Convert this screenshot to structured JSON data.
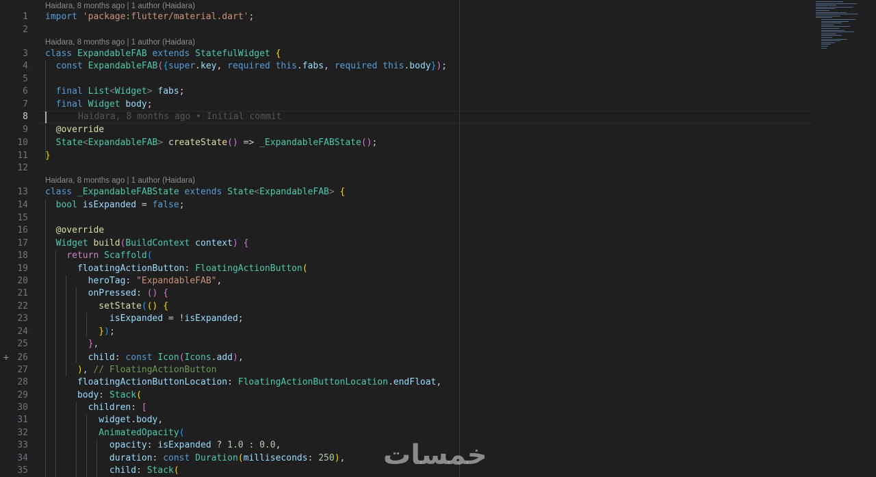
{
  "editor": {
    "theme_colors": {
      "background": "#1f1f1f",
      "keyword": "#569cd6",
      "control": "#c586c0",
      "type": "#4ec9b0",
      "function": "#dcdcaa",
      "variable": "#9cdcfe",
      "string": "#ce9178",
      "number": "#b5cea8",
      "comment": "#6a9955"
    },
    "gutter_marker": "+",
    "line_numbers": [
      "1",
      "2",
      "3",
      "4",
      "5",
      "6",
      "7",
      "8",
      "9",
      "10",
      "11",
      "12",
      "13",
      "14",
      "15",
      "16",
      "17",
      "18",
      "19",
      "20",
      "21",
      "22",
      "23",
      "24",
      "25",
      "26",
      "27",
      "28",
      "29",
      "30",
      "31",
      "32",
      "33",
      "34",
      "35"
    ],
    "active_line": "8",
    "codelens": [
      "Haidara, 8 months ago | 1 author (Haidara)",
      "Haidara, 8 months ago | 1 author (Haidara)",
      "Haidara, 8 months ago | 1 author (Haidara)"
    ],
    "inline_blame": "Haidara, 8 months ago • Initial commit",
    "lines": [
      [
        [
          "k",
          "import"
        ],
        [
          "p",
          " "
        ],
        [
          "s",
          "'package:flutter/material.dart'"
        ],
        [
          "p",
          ";"
        ]
      ],
      [],
      [
        [
          "k",
          "class"
        ],
        [
          "p",
          " "
        ],
        [
          "t",
          "ExpandableFAB"
        ],
        [
          "p",
          " "
        ],
        [
          "k",
          "extends"
        ],
        [
          "p",
          " "
        ],
        [
          "t",
          "StatefulWidget"
        ],
        [
          "p",
          " "
        ],
        [
          "b1",
          "{"
        ]
      ],
      [
        [
          "p",
          "  "
        ],
        [
          "k",
          "const"
        ],
        [
          "p",
          " "
        ],
        [
          "t",
          "ExpandableFAB"
        ],
        [
          "b2",
          "("
        ],
        [
          "b3",
          "{"
        ],
        [
          "k",
          "super"
        ],
        [
          "p",
          "."
        ],
        [
          "v",
          "key"
        ],
        [
          "p",
          ", "
        ],
        [
          "k",
          "required"
        ],
        [
          "p",
          " "
        ],
        [
          "k",
          "this"
        ],
        [
          "p",
          "."
        ],
        [
          "v",
          "fabs"
        ],
        [
          "p",
          ", "
        ],
        [
          "k",
          "required"
        ],
        [
          "p",
          " "
        ],
        [
          "k",
          "this"
        ],
        [
          "p",
          "."
        ],
        [
          "v",
          "body"
        ],
        [
          "b3",
          "}"
        ],
        [
          "b2",
          ")"
        ],
        [
          "p",
          ";"
        ]
      ],
      [],
      [
        [
          "p",
          "  "
        ],
        [
          "k",
          "final"
        ],
        [
          "p",
          " "
        ],
        [
          "t",
          "List"
        ],
        [
          "gt",
          "<"
        ],
        [
          "t",
          "Widget"
        ],
        [
          "gt",
          ">"
        ],
        [
          "p",
          " "
        ],
        [
          "v",
          "fabs"
        ],
        [
          "p",
          ";"
        ]
      ],
      [
        [
          "p",
          "  "
        ],
        [
          "k",
          "final"
        ],
        [
          "p",
          " "
        ],
        [
          "t",
          "Widget"
        ],
        [
          "p",
          " "
        ],
        [
          "v",
          "body"
        ],
        [
          "p",
          ";"
        ]
      ],
      [],
      [
        [
          "p",
          "  "
        ],
        [
          "f",
          "@override"
        ]
      ],
      [
        [
          "p",
          "  "
        ],
        [
          "t",
          "State"
        ],
        [
          "gt",
          "<"
        ],
        [
          "t",
          "ExpandableFAB"
        ],
        [
          "gt",
          ">"
        ],
        [
          "p",
          " "
        ],
        [
          "f",
          "createState"
        ],
        [
          "b2",
          "()"
        ],
        [
          "p",
          " => "
        ],
        [
          "t",
          "_ExpandableFABState"
        ],
        [
          "b2",
          "()"
        ],
        [
          "p",
          ";"
        ]
      ],
      [
        [
          "b1",
          "}"
        ]
      ],
      [],
      [
        [
          "k",
          "class"
        ],
        [
          "p",
          " "
        ],
        [
          "t",
          "_ExpandableFABState"
        ],
        [
          "p",
          " "
        ],
        [
          "k",
          "extends"
        ],
        [
          "p",
          " "
        ],
        [
          "t",
          "State"
        ],
        [
          "gt",
          "<"
        ],
        [
          "t",
          "ExpandableFAB"
        ],
        [
          "gt",
          ">"
        ],
        [
          "p",
          " "
        ],
        [
          "b1",
          "{"
        ]
      ],
      [
        [
          "p",
          "  "
        ],
        [
          "t",
          "bool"
        ],
        [
          "p",
          " "
        ],
        [
          "v",
          "isExpanded"
        ],
        [
          "p",
          " = "
        ],
        [
          "k",
          "false"
        ],
        [
          "p",
          ";"
        ]
      ],
      [],
      [
        [
          "p",
          "  "
        ],
        [
          "f",
          "@override"
        ]
      ],
      [
        [
          "p",
          "  "
        ],
        [
          "t",
          "Widget"
        ],
        [
          "p",
          " "
        ],
        [
          "f",
          "build"
        ],
        [
          "b2",
          "("
        ],
        [
          "t",
          "BuildContext"
        ],
        [
          "p",
          " "
        ],
        [
          "v",
          "context"
        ],
        [
          "b2",
          ")"
        ],
        [
          "p",
          " "
        ],
        [
          "b2",
          "{"
        ]
      ],
      [
        [
          "p",
          "    "
        ],
        [
          "c",
          "return"
        ],
        [
          "p",
          " "
        ],
        [
          "t",
          "Scaffold"
        ],
        [
          "b3",
          "("
        ]
      ],
      [
        [
          "p",
          "      "
        ],
        [
          "v",
          "floatingActionButton"
        ],
        [
          "p",
          ": "
        ],
        [
          "t",
          "FloatingActionButton"
        ],
        [
          "b1",
          "("
        ]
      ],
      [
        [
          "p",
          "        "
        ],
        [
          "v",
          "heroTag"
        ],
        [
          "p",
          ": "
        ],
        [
          "s",
          "\"ExpandableFAB\""
        ],
        [
          "p",
          ","
        ]
      ],
      [
        [
          "p",
          "        "
        ],
        [
          "v",
          "onPressed"
        ],
        [
          "p",
          ": "
        ],
        [
          "b2",
          "()"
        ],
        [
          "p",
          " "
        ],
        [
          "b2",
          "{"
        ]
      ],
      [
        [
          "p",
          "          "
        ],
        [
          "f",
          "setState"
        ],
        [
          "b3",
          "("
        ],
        [
          "b1",
          "()"
        ],
        [
          "p",
          " "
        ],
        [
          "b1",
          "{"
        ]
      ],
      [
        [
          "p",
          "            "
        ],
        [
          "v",
          "isExpanded"
        ],
        [
          "p",
          " = !"
        ],
        [
          "v",
          "isExpanded"
        ],
        [
          "p",
          ";"
        ]
      ],
      [
        [
          "p",
          "          "
        ],
        [
          "b1",
          "}"
        ],
        [
          "b3",
          ")"
        ],
        [
          "p",
          ";"
        ]
      ],
      [
        [
          "p",
          "        "
        ],
        [
          "b2",
          "}"
        ],
        [
          "p",
          ","
        ]
      ],
      [
        [
          "p",
          "        "
        ],
        [
          "v",
          "child"
        ],
        [
          "p",
          ": "
        ],
        [
          "k",
          "const"
        ],
        [
          "p",
          " "
        ],
        [
          "t",
          "Icon"
        ],
        [
          "b2",
          "("
        ],
        [
          "t",
          "Icons"
        ],
        [
          "p",
          "."
        ],
        [
          "v",
          "add"
        ],
        [
          "b2",
          ")"
        ],
        [
          "p",
          ","
        ]
      ],
      [
        [
          "p",
          "      "
        ],
        [
          "b1",
          ")"
        ],
        [
          "p",
          ", "
        ],
        [
          "cm",
          "// FloatingActionButton"
        ]
      ],
      [
        [
          "p",
          "      "
        ],
        [
          "v",
          "floatingActionButtonLocation"
        ],
        [
          "p",
          ": "
        ],
        [
          "t",
          "FloatingActionButtonLocation"
        ],
        [
          "p",
          "."
        ],
        [
          "v",
          "endFloat"
        ],
        [
          "p",
          ","
        ]
      ],
      [
        [
          "p",
          "      "
        ],
        [
          "v",
          "body"
        ],
        [
          "p",
          ": "
        ],
        [
          "t",
          "Stack"
        ],
        [
          "b1",
          "("
        ]
      ],
      [
        [
          "p",
          "        "
        ],
        [
          "v",
          "children"
        ],
        [
          "p",
          ": "
        ],
        [
          "b2",
          "["
        ]
      ],
      [
        [
          "p",
          "          "
        ],
        [
          "v",
          "widget"
        ],
        [
          "p",
          "."
        ],
        [
          "v",
          "body"
        ],
        [
          "p",
          ","
        ]
      ],
      [
        [
          "p",
          "          "
        ],
        [
          "t",
          "AnimatedOpacity"
        ],
        [
          "b3",
          "("
        ]
      ],
      [
        [
          "p",
          "            "
        ],
        [
          "v",
          "opacity"
        ],
        [
          "p",
          ": "
        ],
        [
          "v",
          "isExpanded"
        ],
        [
          "p",
          " ? "
        ],
        [
          "n",
          "1.0"
        ],
        [
          "p",
          " : "
        ],
        [
          "n",
          "0.0"
        ],
        [
          "p",
          ","
        ]
      ],
      [
        [
          "p",
          "            "
        ],
        [
          "v",
          "duration"
        ],
        [
          "p",
          ": "
        ],
        [
          "k",
          "const"
        ],
        [
          "p",
          " "
        ],
        [
          "t",
          "Duration"
        ],
        [
          "b1",
          "("
        ],
        [
          "v",
          "milliseconds"
        ],
        [
          "p",
          ": "
        ],
        [
          "n",
          "250"
        ],
        [
          "b1",
          ")"
        ],
        [
          "p",
          ","
        ]
      ],
      [
        [
          "p",
          "            "
        ],
        [
          "v",
          "child"
        ],
        [
          "p",
          ": "
        ],
        [
          "t",
          "Stack"
        ],
        [
          "b1",
          "("
        ]
      ]
    ]
  },
  "watermark": {
    "text": "خمسات"
  }
}
